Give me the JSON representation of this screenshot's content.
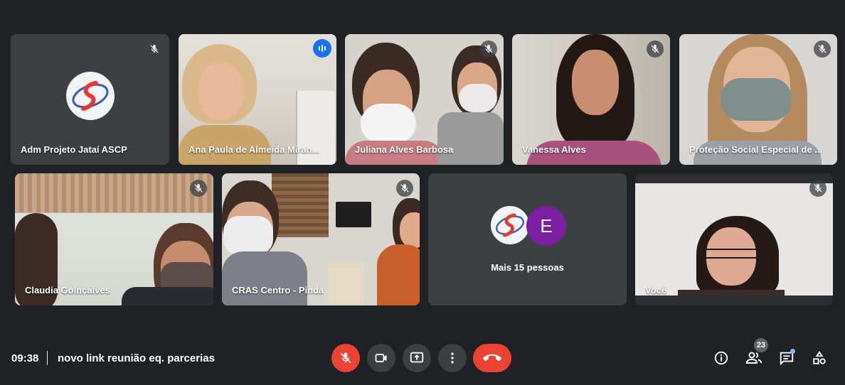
{
  "colors": {
    "background": "#202124",
    "tile": "#3c4043",
    "active_outline": "#8ab4f8",
    "speaking": "#1a73e8",
    "mic_off_button": "#ea4335",
    "hangup_button": "#ea4335",
    "avatar_purple": "#7b1fa2"
  },
  "participants": [
    {
      "name": "Adm Projeto Jataí ASCP",
      "muted": true,
      "video": "logo"
    },
    {
      "name": "Ana Paula de Almeida Miran...",
      "muted": false,
      "speaking": true
    },
    {
      "name": "Juliana Alves Barbosa",
      "muted": true
    },
    {
      "name": "Vanessa Alves",
      "muted": true
    },
    {
      "name": "Proteção Social Especial de ...",
      "muted": true
    },
    {
      "name": "Claudia Golnçalves",
      "muted": true
    },
    {
      "name": "CRAS Centro - Pinda",
      "muted": true
    },
    {
      "name": "Mais 15 pessoas",
      "avatar_letter": "E"
    },
    {
      "name": "Você",
      "muted": true
    }
  ],
  "meeting": {
    "time": "09:38",
    "title": "novo link reunião eq. parcerias"
  },
  "controls": {
    "icons": [
      "mic-off-icon",
      "camera-icon",
      "present-icon",
      "more-vert-icon",
      "call-end-icon"
    ]
  },
  "right_controls": {
    "people_count": "23",
    "icons": [
      "info-icon",
      "people-icon",
      "chat-icon",
      "activities-icon"
    ]
  }
}
